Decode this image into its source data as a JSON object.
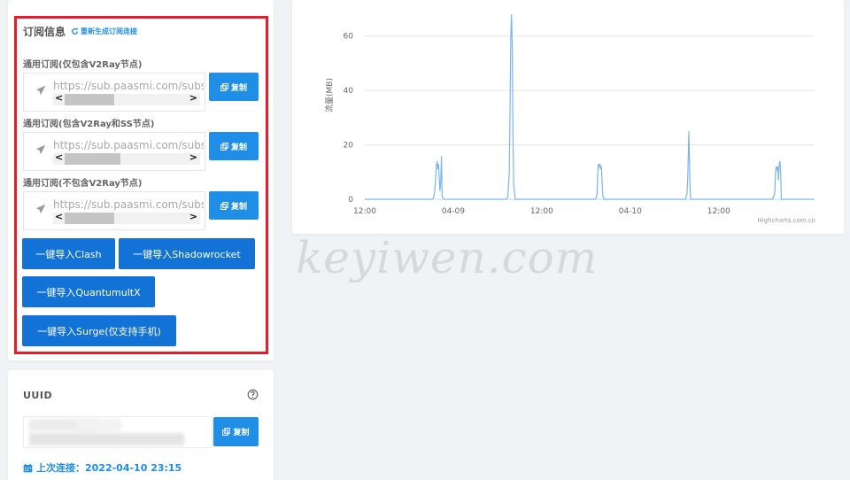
{
  "subscription": {
    "title": "订阅信息",
    "regenerate_label": "重新生成订阅连接",
    "groups": [
      {
        "label": "通用订阅(仅包含V2Ray节点)",
        "url": "https://sub.paasmi.com/subs",
        "copy_label": "复制",
        "scroll_thumb": 0.4
      },
      {
        "label": "通用订阅(包含V2Ray和SS节点)",
        "url": "https://sub.paasmi.com/subs",
        "copy_label": "复制",
        "scroll_thumb": 0.45
      },
      {
        "label": "通用订阅(不包含V2Ray节点)",
        "url": "https://sub.paasmi.com/subs",
        "copy_label": "复制",
        "scroll_thumb": 0.4
      }
    ],
    "import_buttons": [
      {
        "label": "一键导入Clash"
      },
      {
        "label": "一键导入Shadowrocket"
      },
      {
        "label": "一键导入QuantumultX"
      },
      {
        "label": "一键导入Surge(仅支持手机)"
      }
    ]
  },
  "uuid": {
    "title": "UUID",
    "copy_label": "复制",
    "last_connection": "上次连接：2022-04-10 23:15"
  },
  "watermark": "keyiwen.com",
  "chart_data": {
    "type": "line",
    "ylabel": "流量(MB)",
    "xlabel": "",
    "ylim": [
      0,
      70
    ],
    "yticks": [
      0,
      20,
      40,
      60
    ],
    "xticks": [
      {
        "t": 0,
        "label": "12:00"
      },
      {
        "t": 12,
        "label": "04-09"
      },
      {
        "t": 24,
        "label": "12:00"
      },
      {
        "t": 36,
        "label": "04-10"
      },
      {
        "t": 48,
        "label": "12:00"
      }
    ],
    "x_unit": "hours since 2022-04-08 12:00",
    "series": [
      {
        "color": "#7cb5ec",
        "points": [
          [
            0,
            0
          ],
          [
            9.0,
            0
          ],
          [
            9.3,
            0.3
          ],
          [
            9.5,
            3
          ],
          [
            9.7,
            12
          ],
          [
            9.8,
            14
          ],
          [
            9.9,
            11
          ],
          [
            10.0,
            13
          ],
          [
            10.1,
            8
          ],
          [
            10.2,
            3
          ],
          [
            10.3,
            7
          ],
          [
            10.4,
            16
          ],
          [
            10.5,
            1
          ],
          [
            10.7,
            0
          ],
          [
            19.2,
            0
          ],
          [
            19.4,
            1
          ],
          [
            19.6,
            10
          ],
          [
            19.7,
            35
          ],
          [
            19.8,
            60
          ],
          [
            19.9,
            68
          ],
          [
            20.0,
            55
          ],
          [
            20.1,
            22
          ],
          [
            20.2,
            5
          ],
          [
            20.4,
            0
          ],
          [
            31.3,
            0
          ],
          [
            31.5,
            2
          ],
          [
            31.6,
            10
          ],
          [
            31.7,
            13
          ],
          [
            31.8,
            12
          ],
          [
            31.9,
            13
          ],
          [
            32.0,
            11
          ],
          [
            32.1,
            12
          ],
          [
            32.2,
            5
          ],
          [
            32.3,
            1
          ],
          [
            32.5,
            0
          ],
          [
            43.5,
            0
          ],
          [
            43.7,
            2
          ],
          [
            43.8,
            8
          ],
          [
            43.95,
            25
          ],
          [
            44.1,
            5
          ],
          [
            44.2,
            0
          ],
          [
            55.3,
            0
          ],
          [
            55.6,
            2
          ],
          [
            55.7,
            10
          ],
          [
            55.8,
            12
          ],
          [
            55.9,
            11
          ],
          [
            56.0,
            12
          ],
          [
            56.1,
            7
          ],
          [
            56.2,
            13
          ],
          [
            56.3,
            14
          ],
          [
            56.4,
            10
          ],
          [
            56.5,
            0
          ],
          [
            61,
            0
          ]
        ]
      }
    ],
    "x_max": 61,
    "credit": "Highcharts.com.cn",
    "grid": true
  }
}
